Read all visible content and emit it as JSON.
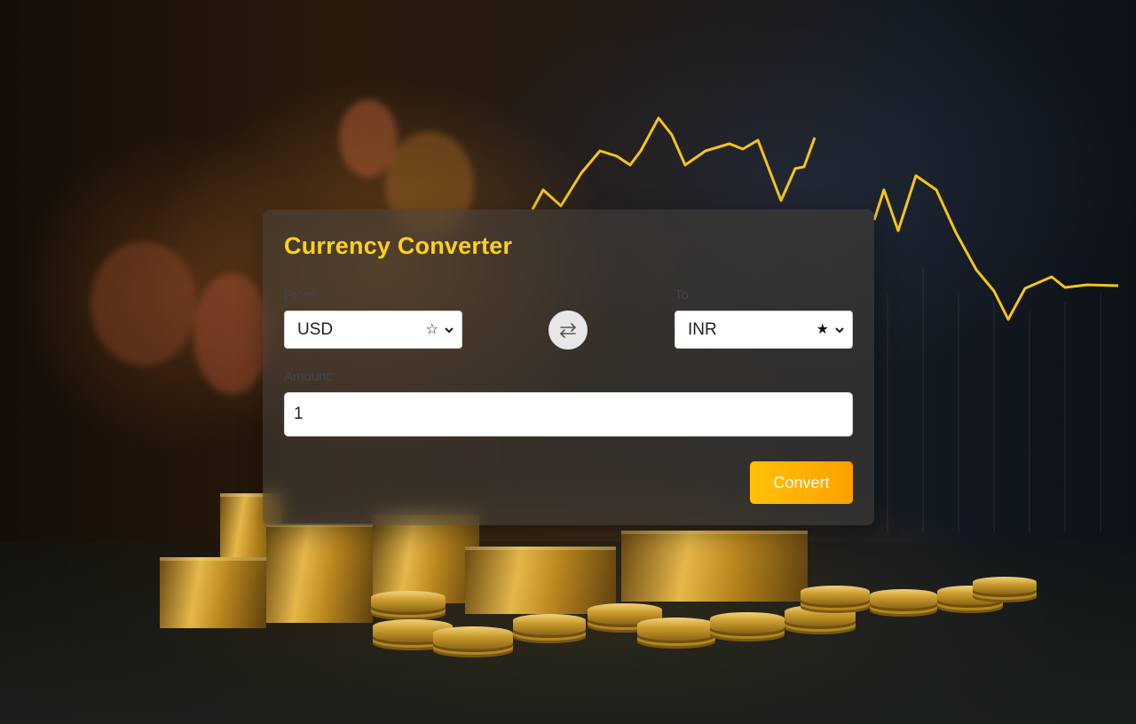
{
  "converter": {
    "title": "Currency Converter",
    "from_label": "From:",
    "to_label": "To:",
    "from_currency": "USD",
    "to_currency": "INR",
    "from_star": "☆",
    "to_star": "★",
    "amount_label": "Amount:",
    "amount_value": "1",
    "convert_label": "Convert",
    "swap_icon": "swap-arrows-icon"
  },
  "colors": {
    "title": "#ffd21a",
    "button_start": "#ffc107",
    "button_end": "#ffa000",
    "chart_line": "#f5c518"
  }
}
